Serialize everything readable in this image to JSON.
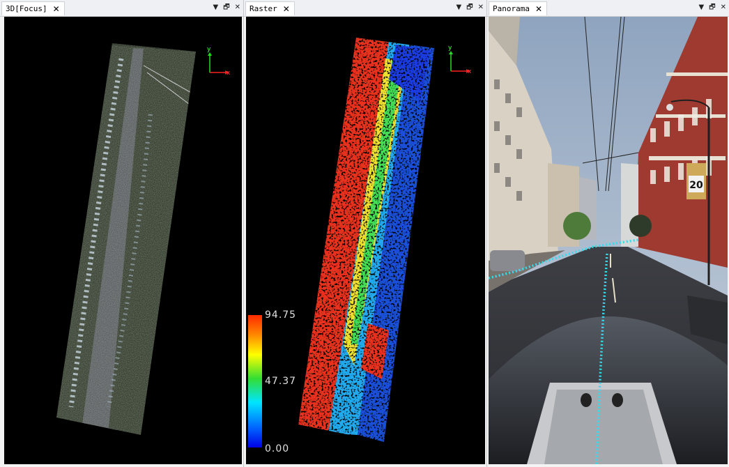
{
  "panes": {
    "focus": {
      "tab_label": "3D[Focus]",
      "axis_x": "x",
      "axis_y": "y"
    },
    "raster": {
      "tab_label": "Raster",
      "axis_x": "x",
      "axis_y": "y",
      "legend": {
        "max": "94.75",
        "mid": "47.37",
        "min": "0.00"
      }
    },
    "panorama": {
      "tab_label": "Panorama",
      "sign_number": "20"
    }
  },
  "controls": {
    "dropdown": "▼",
    "restore": "🗗",
    "close": "✕"
  },
  "colors": {
    "axis_x": "#ff2020",
    "axis_y": "#20dd20",
    "trajectory": "#33ddee"
  }
}
